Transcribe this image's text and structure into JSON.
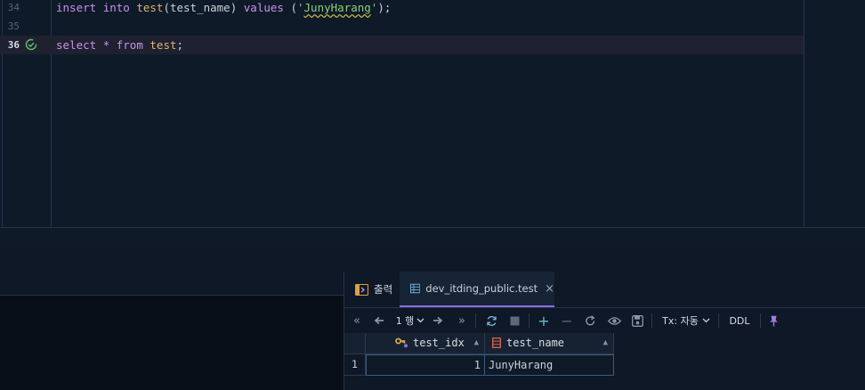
{
  "editor": {
    "lines": [
      {
        "number": "34",
        "tokens": [
          {
            "t": "insert",
            "c": "kw"
          },
          {
            "t": " ",
            "c": "plain"
          },
          {
            "t": "into",
            "c": "kw"
          },
          {
            "t": " ",
            "c": "plain"
          },
          {
            "t": "test",
            "c": "fn"
          },
          {
            "t": "(",
            "c": "plain"
          },
          {
            "t": "test_name",
            "c": "plain"
          },
          {
            "t": ") ",
            "c": "plain"
          },
          {
            "t": "values",
            "c": "kw"
          },
          {
            "t": " (",
            "c": "plain"
          },
          {
            "t": "'",
            "c": "str"
          },
          {
            "t": "JunyHarang",
            "c": "str wavy"
          },
          {
            "t": "'",
            "c": "str"
          },
          {
            "t": ");",
            "c": "plain"
          }
        ]
      },
      {
        "number": "35",
        "tokens": []
      },
      {
        "number": "36",
        "tokens": [
          {
            "t": "select",
            "c": "kw"
          },
          {
            "t": " ",
            "c": "plain"
          },
          {
            "t": "*",
            "c": "kw"
          },
          {
            "t": " ",
            "c": "plain"
          },
          {
            "t": "from",
            "c": "kw"
          },
          {
            "t": " ",
            "c": "plain"
          },
          {
            "t": "test",
            "c": "fn"
          },
          {
            "t": ";",
            "c": "plain"
          }
        ]
      }
    ]
  },
  "results": {
    "tabs": {
      "output_label": "출력",
      "table_label": "dev_itding_public.test",
      "close_glyph": "×"
    },
    "toolbar": {
      "first": "«",
      "prev": "🠔",
      "rows_label": "1 행",
      "next": "➡",
      "last": "»",
      "add": "+",
      "remove": "−",
      "tx_label": "Tx: 자동",
      "ddl_label": "DDL"
    },
    "grid": {
      "columns": [
        "test_idx",
        "test_name"
      ],
      "rows": [
        {
          "row_number": "1",
          "test_idx": "1",
          "test_name": "JunyHarang"
        }
      ]
    }
  },
  "colors": {
    "accent": "#8a6ee0",
    "keyword": "#c792ea",
    "function": "#e0b36f",
    "string": "#8ccf78",
    "success": "#5fbf6f"
  }
}
